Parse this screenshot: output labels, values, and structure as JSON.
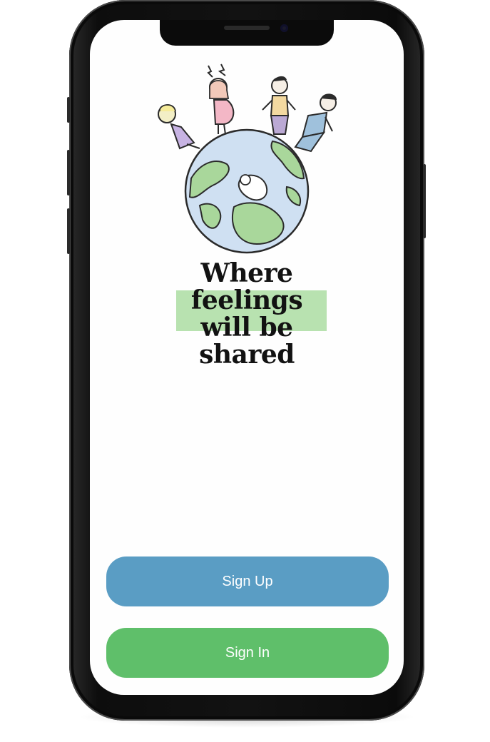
{
  "headline": {
    "line1": "Where",
    "line2": "feelings",
    "line3": "will be",
    "line4": "shared"
  },
  "buttons": {
    "signup_label": "Sign Up",
    "signin_label": "Sign In"
  },
  "colors": {
    "signup": "#5a9dc4",
    "signin": "#5fbf6a",
    "highlight": "#b8e2b0"
  }
}
